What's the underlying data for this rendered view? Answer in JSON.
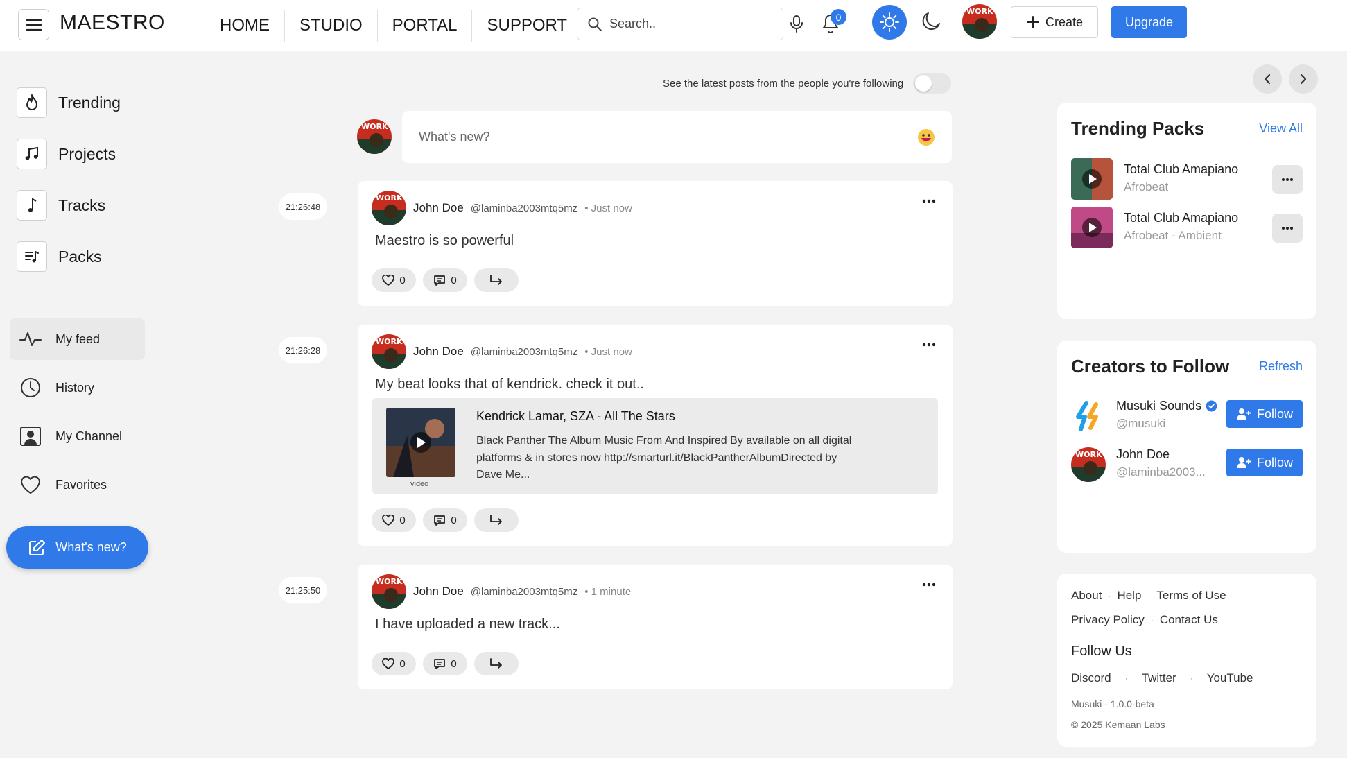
{
  "header": {
    "brand": "MAESTRO",
    "nav": [
      "HOME",
      "STUDIO",
      "PORTAL",
      "SUPPORT"
    ],
    "search_placeholder": "Search..",
    "notification_count": "0",
    "create_label": "Create",
    "upgrade_label": "Upgrade"
  },
  "sidebar": {
    "top_items": [
      {
        "label": "Trending",
        "icon": "fire-icon"
      },
      {
        "label": "Projects",
        "icon": "music-notes-icon"
      },
      {
        "label": "Tracks",
        "icon": "music-note-icon"
      },
      {
        "label": "Packs",
        "icon": "playlist-icon"
      }
    ],
    "nav_items": [
      {
        "label": "My feed",
        "icon": "activity-icon",
        "active": true
      },
      {
        "label": "History",
        "icon": "clock-icon"
      },
      {
        "label": "My Channel",
        "icon": "channel-icon"
      },
      {
        "label": "Favorites",
        "icon": "heart-icon"
      }
    ],
    "fab_label": "What's new?"
  },
  "feed": {
    "following_toggle_label": "See the latest posts from the people you're following",
    "composer_placeholder": "What's new?",
    "posts": [
      {
        "timestamp": "21:26:48",
        "name": "John Doe",
        "handle": "@laminba2003mtq5mz",
        "time_ago": "Just now",
        "text": "Maestro is so powerful",
        "likes": "0",
        "comments": "0"
      },
      {
        "timestamp": "21:26:28",
        "name": "John Doe",
        "handle": "@laminba2003mtq5mz",
        "time_ago": "Just now",
        "text": "My beat looks that of kendrick. check it out..",
        "likes": "0",
        "comments": "0",
        "embed": {
          "title": "Kendrick Lamar, SZA - All The Stars",
          "description": "Black Panther The Album Music From And Inspired By available on all digital platforms & in stores now http://smarturl.it/BlackPantherAlbumDirected by Dave Me...",
          "caption": "video"
        }
      },
      {
        "timestamp": "21:25:50",
        "name": "John Doe",
        "handle": "@laminba2003mtq5mz",
        "time_ago": "1 minute",
        "text": "I have uploaded a new track...",
        "likes": "0",
        "comments": "0"
      }
    ]
  },
  "right": {
    "trending_packs": {
      "title": "Trending Packs",
      "link": "View All",
      "items": [
        {
          "title": "Total Club Amapiano",
          "genre": "Afrobeat"
        },
        {
          "title": "Total Club Amapiano",
          "genre": "Afrobeat - Ambient"
        }
      ]
    },
    "creators": {
      "title": "Creators to Follow",
      "link": "Refresh",
      "follow_label": "Follow",
      "items": [
        {
          "name": "Musuki Sounds",
          "handle": "@musuki",
          "verified": true
        },
        {
          "name": "John Doe",
          "handle": "@laminba2003...",
          "verified": false
        }
      ]
    },
    "footer": {
      "links_row1": [
        "About",
        "Help",
        "Terms of Use"
      ],
      "links_row2": [
        "Privacy Policy",
        "Contact Us"
      ],
      "follow_us": "Follow Us",
      "social": [
        "Discord",
        "Twitter",
        "YouTube"
      ],
      "version": "Musuki - 1.0.0-beta",
      "copyright": "© 2025 Kemaan Labs"
    }
  },
  "colors": {
    "accent": "#2f7ae8",
    "background": "#f3f3f3"
  }
}
